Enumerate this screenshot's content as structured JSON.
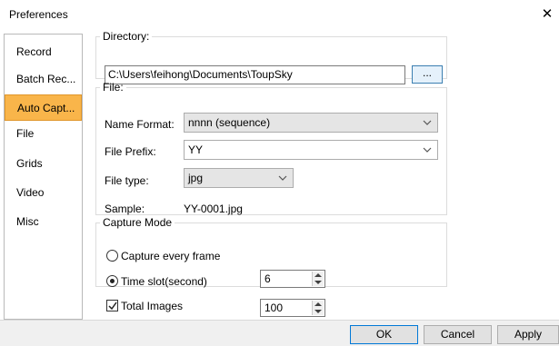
{
  "window": {
    "title": "Preferences",
    "close_glyph": "✕"
  },
  "sidebar": {
    "items": [
      {
        "label": "Record"
      },
      {
        "label": "Batch Rec..."
      },
      {
        "label": "Auto Capt..."
      },
      {
        "label": "File"
      },
      {
        "label": "Grids"
      },
      {
        "label": "Video"
      },
      {
        "label": "Misc"
      }
    ],
    "selected_index": 2
  },
  "directory": {
    "legend": "Directory:",
    "path": "C:\\Users\\feihong\\Documents\\ToupSky",
    "browse_label": "..."
  },
  "file": {
    "legend": "File:",
    "name_format_label": "Name Format:",
    "name_format_value": "nnnn (sequence)",
    "prefix_label": "File Prefix:",
    "prefix_value": "YY",
    "type_label": "File type:",
    "type_value": "jpg",
    "sample_label": "Sample:",
    "sample_value": "YY-0001.jpg"
  },
  "capture_mode": {
    "legend": "Capture Mode",
    "every_frame_label": "Capture every frame",
    "every_frame_checked": false,
    "time_slot_label": "Time slot(second)",
    "time_slot_checked": true,
    "time_slot_value": "6"
  },
  "total_images": {
    "label": "Total Images",
    "checked": true,
    "value": "100"
  },
  "buttons": {
    "ok": "OK",
    "cancel": "Cancel",
    "apply": "Apply"
  },
  "colors": {
    "selected_bg": "#f9b54a",
    "accent": "#0078d7",
    "footer_bg": "#f0f0f0"
  }
}
